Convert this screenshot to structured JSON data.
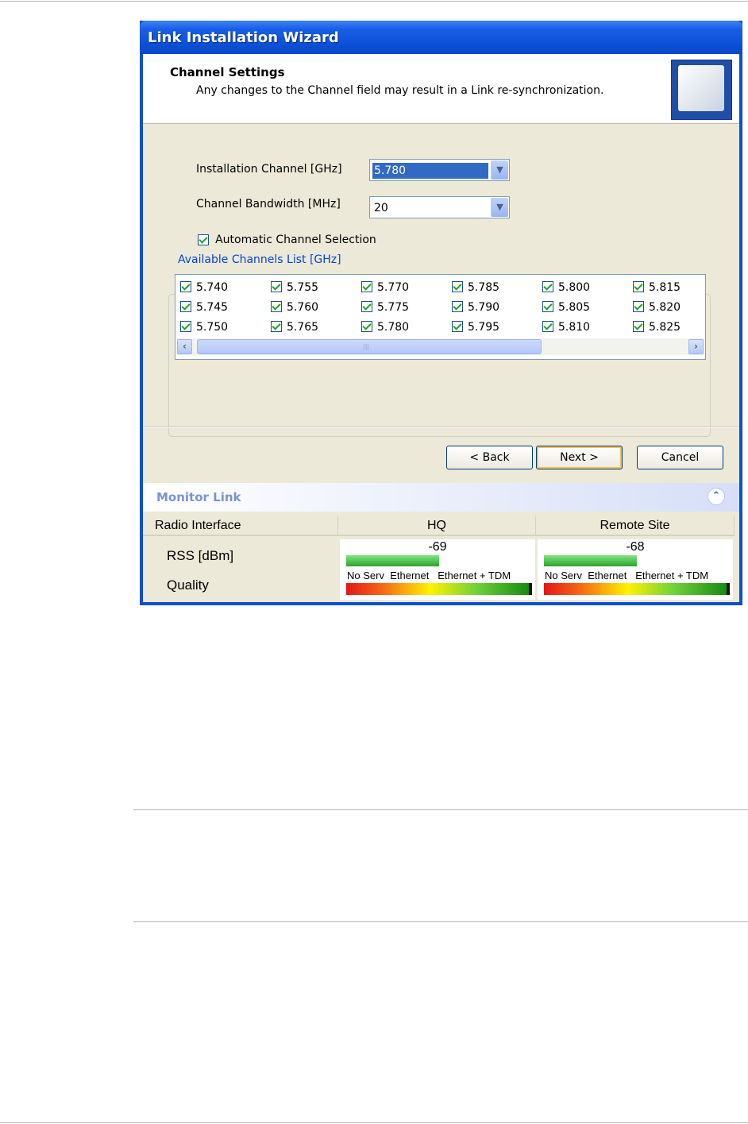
{
  "window": {
    "title": "Link Installation Wizard"
  },
  "header": {
    "title": "Channel Settings",
    "subtitle": "Any changes to the Channel field may result in a Link re-synchronization."
  },
  "form": {
    "installation_channel_label": "Installation Channel [GHz]",
    "installation_channel_value": "5.780",
    "bandwidth_label": "Channel Bandwidth [MHz]",
    "bandwidth_value": "20",
    "auto_selection_label": "Automatic Channel Selection",
    "auto_selection_checked": true
  },
  "channels": {
    "legend": "Available Channels List [GHz]",
    "items": [
      {
        "value": "5.740",
        "checked": true
      },
      {
        "value": "5.745",
        "checked": true
      },
      {
        "value": "5.750",
        "checked": true
      },
      {
        "value": "5.755",
        "checked": true
      },
      {
        "value": "5.760",
        "checked": true
      },
      {
        "value": "5.765",
        "checked": true
      },
      {
        "value": "5.770",
        "checked": true
      },
      {
        "value": "5.775",
        "checked": true
      },
      {
        "value": "5.780",
        "checked": true
      },
      {
        "value": "5.785",
        "checked": true
      },
      {
        "value": "5.790",
        "checked": true
      },
      {
        "value": "5.795",
        "checked": true
      },
      {
        "value": "5.800",
        "checked": true
      },
      {
        "value": "5.805",
        "checked": true
      },
      {
        "value": "5.810",
        "checked": true
      },
      {
        "value": "5.815",
        "checked": true
      },
      {
        "value": "5.820",
        "checked": true
      },
      {
        "value": "5.825",
        "checked": true
      }
    ]
  },
  "buttons": {
    "back": "< Back",
    "next": "Next >",
    "cancel": "Cancel"
  },
  "monitor": {
    "title": "Monitor Link",
    "columns": [
      "Radio Interface",
      "HQ",
      "Remote Site"
    ],
    "rss_label": "RSS [dBm]",
    "quality_label": "Quality",
    "hq_rss": "-69",
    "remote_rss": "-68",
    "quality_scale": [
      "No Serv",
      "Ethernet",
      "Ethernet + TDM"
    ]
  }
}
